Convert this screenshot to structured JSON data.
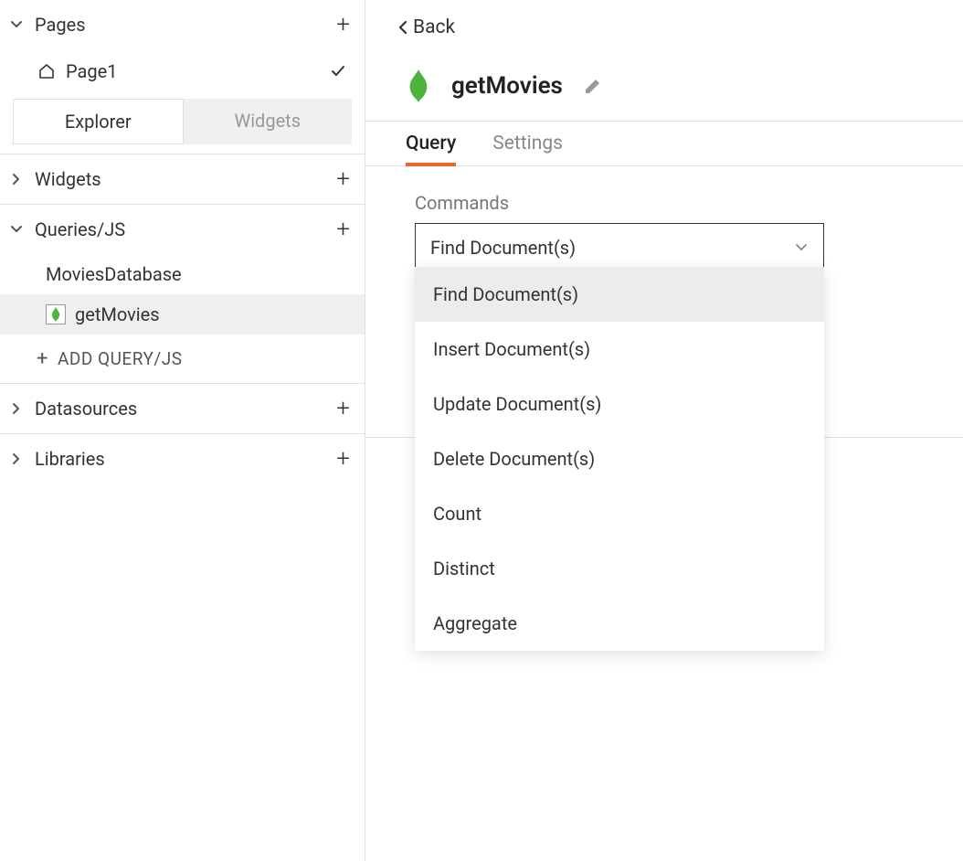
{
  "sidebar": {
    "pages": {
      "label": "Pages",
      "items": [
        {
          "label": "Page1"
        }
      ]
    },
    "switcher": {
      "explorer": "Explorer",
      "widgets": "Widgets"
    },
    "widgets_section": "Widgets",
    "queries_section": "Queries/JS",
    "queries": {
      "datasource": "MoviesDatabase",
      "items": [
        {
          "label": "getMovies"
        }
      ],
      "add_label": "ADD QUERY/JS"
    },
    "datasources_section": "Datasources",
    "libraries_section": "Libraries"
  },
  "main": {
    "back": "Back",
    "title": "getMovies",
    "tabs": {
      "query": "Query",
      "settings": "Settings"
    },
    "commands_label": "Commands",
    "select_value": "Find Document(s)",
    "options": [
      "Find Document(s)",
      "Insert Document(s)",
      "Update Document(s)",
      "Delete Document(s)",
      "Count",
      "Distinct",
      "Aggregate"
    ]
  }
}
